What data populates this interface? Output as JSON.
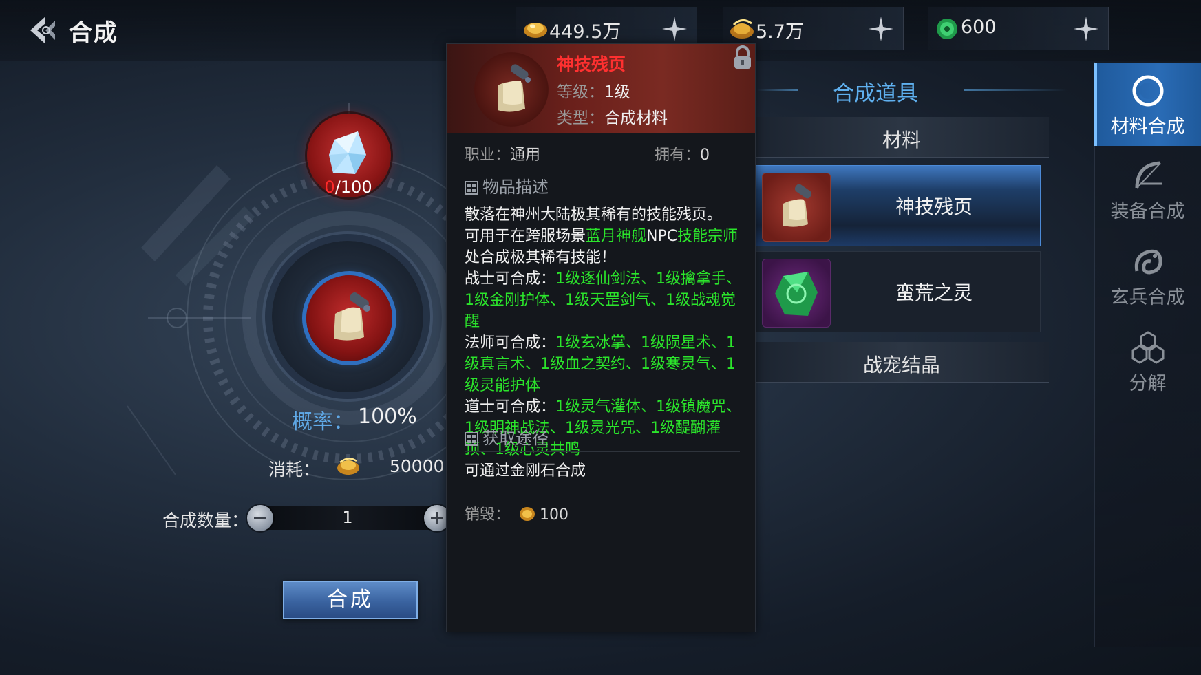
{
  "header": {
    "title": "合成",
    "currencies": [
      {
        "icon": "gold-ingot-icon",
        "value": "449.5万"
      },
      {
        "icon": "bound-gold-ingot-icon",
        "value": "5.7万"
      },
      {
        "icon": "jade-coin-icon",
        "value": "600"
      }
    ]
  },
  "synth": {
    "material_have": "0",
    "material_need": "/100",
    "probability_label": "概率：",
    "probability_value": "100%",
    "cost_label": "消耗：",
    "cost_value": "50000",
    "quantity_label": "合成数量：",
    "quantity_value": "1",
    "button_label": "合成"
  },
  "tooltip": {
    "name": "神技残页",
    "level_key": "等级：",
    "level_value": "1级",
    "type_key": "类型：",
    "type_value": "合成材料",
    "class_key": "职业：",
    "class_value": "通用",
    "owned_key": "拥有：",
    "owned_value": "0",
    "desc_header": "物品描述",
    "desc": {
      "p1": "散落在神州大陆极其稀有的技能残页。",
      "p2a": "可用于在跨服场景",
      "p2b": "蓝月神舰",
      "p2c": "NPC",
      "p2d": "技能宗师",
      "p2e": "处合成极其稀有技能！",
      "warrior_key": "战士可合成：",
      "warrior_skills": "1级逐仙剑法、1级擒拿手、1级金刚护体、1级天罡剑气、1级战魂觉醒",
      "mage_key": "法师可合成：",
      "mage_skills": "1级玄冰掌、1级陨星术、1级真言术、1级血之契约、1级寒灵气、1级灵能护体",
      "taoist_key": "道士可合成：",
      "taoist_skills": "1级灵气灌体、1级镇魔咒、1级明神战法、1级灵光咒、1级醍醐灌顶、1级心灵共鸣"
    },
    "source_header": "获取途径",
    "source_text": "可通过金刚石合成",
    "destroy_key": "销毁：",
    "destroy_value": "100"
  },
  "list": {
    "title": "合成道具",
    "category_materials": "材料",
    "items": [
      {
        "label": "神技残页",
        "selected": true
      },
      {
        "label": "蛮荒之灵",
        "selected": false
      }
    ],
    "category_pet": "战宠结晶"
  },
  "sidebar": {
    "items": [
      {
        "label": "材料合成",
        "active": true
      },
      {
        "label": "装备合成",
        "active": false
      },
      {
        "label": "玄兵合成",
        "active": false
      },
      {
        "label": "分解",
        "active": false
      }
    ]
  },
  "colors": {
    "accent_blue": "#5fb0ef",
    "item_name_red": "#ff3030",
    "highlight_green": "#2be52b"
  }
}
